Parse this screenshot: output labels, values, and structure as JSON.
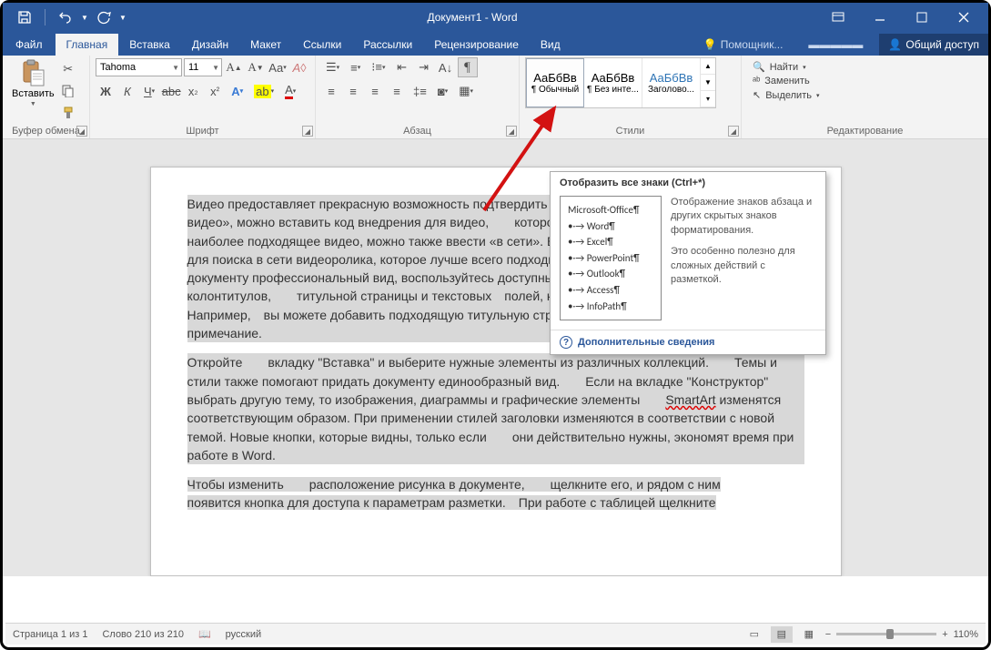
{
  "window": {
    "title": "Документ1 - Word"
  },
  "tabs": {
    "file": "Файл",
    "items": [
      "Главная",
      "Вставка",
      "Дизайн",
      "Макет",
      "Ссылки",
      "Рассылки",
      "Рецензирование",
      "Вид"
    ],
    "tell_me": "Помощник...",
    "share": "Общий доступ"
  },
  "ribbon": {
    "clipboard": {
      "paste": "Вставить",
      "label": "Буфер обмена"
    },
    "font": {
      "name": "Tahoma",
      "size": "11",
      "label": "Шрифт"
    },
    "paragraph": {
      "label": "Абзац"
    },
    "styles": {
      "label": "Стили",
      "items": [
        {
          "preview": "АаБбВв",
          "name": "¶ Обычный"
        },
        {
          "preview": "АаБбВв",
          "name": "¶ Без инте..."
        },
        {
          "preview": "АаБбВв",
          "name": "Заголово..."
        }
      ]
    },
    "editing": {
      "label": "Редактирование",
      "find": "Найти",
      "replace": "Заменить",
      "select": "Выделить"
    }
  },
  "tooltip": {
    "title": "Отобразить все знаки (Ctrl+*)",
    "sample_header": "Microsoft·Office¶",
    "sample_items": [
      "Word¶",
      "Excel¶",
      "PowerPoint¶",
      "Outlook¶",
      "Access¶",
      "InfoPath¶"
    ],
    "desc1": "Отображение знаков абзаца и других скрытых знаков форматирования.",
    "desc2": "Это особенно полезно для сложных действий с разметкой.",
    "more": "Дополнительные сведения"
  },
  "document": {
    "p1": "Видео предоставляет прекрасную возможность подтвердить свою точку зрения. Нажав «Интернет-видео», можно вставить код внедрения для видео,  которое требуется добавить. Чтобы найти наиболее подходящее видео, можно также ввести «в сети». Вы также можете ввести ключевое слово для поиска в сети видеоролика, которое лучше всего подходит для вашего документа. Чтобы придать документу профессиональный вид, воспользуйтесь доступными в Word макетами верхних и нижних колонтитулов,  титульной страницы и текстовых полей, которые дополняют друг друга. Например, вы можете добавить подходящую титульную страницу, верхний колонтитул и боковое примечание.",
    "p2a": "Откройте  вкладку \"Вставка\" и выберите нужные элементы из различных коллекций.  Темы и стили также помогают придать документу единообразный вид.  Если на вкладке \"Конструктор\"  выбрать другую тему, то изображения, диаграммы и графические элементы  ",
    "p2_smart": "SmartArt",
    "p2b": " изменятся соответствующим образом. При применении стилей заголовки изменяются в соответствии с новой темой. Новые кнопки, которые видны, только если  они действительно нужны, экономят время при работе в Word.",
    "p3a": "Чтобы изменить  расположение рисунка в документе,  щелкните его, и рядом с ним",
    "p3b": "появится кнопка для доступа к параметрам разметки. При работе с таблицей щелкните"
  },
  "status": {
    "page": "Страница 1 из 1",
    "words": "Слово 210 из 210",
    "lang": "русский",
    "zoom": "110%"
  }
}
